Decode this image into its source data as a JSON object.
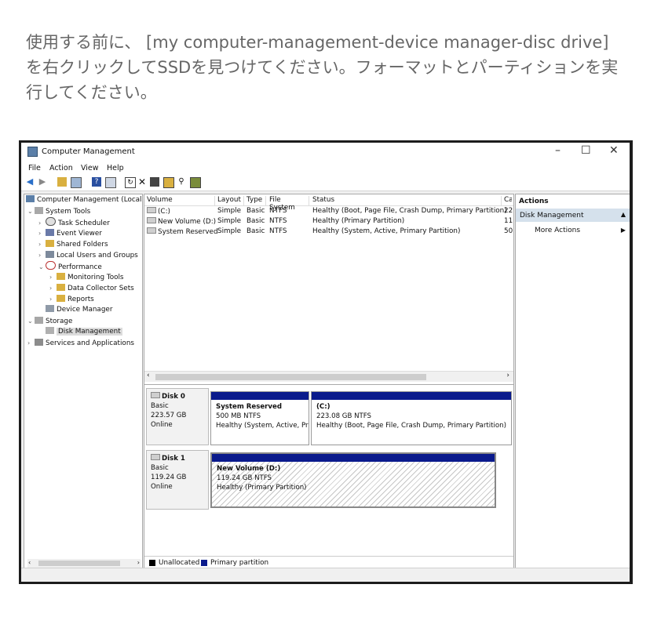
{
  "intro": {
    "text": "使用する前に、 [my computer-management-device manager-disc drive] を右クリックしてSSDを見つけてください。フォーマットとパーティションを実行してください。"
  },
  "window": {
    "title": "Computer Management",
    "controls": {
      "minimize": "–",
      "maximize": "☐",
      "close": "✕"
    }
  },
  "menu": [
    "File",
    "Action",
    "View",
    "Help"
  ],
  "tree": {
    "root": "Computer Management (Local",
    "system_tools": "System Tools",
    "task_scheduler": "Task Scheduler",
    "event_viewer": "Event Viewer",
    "shared_folders": "Shared Folders",
    "local_users": "Local Users and Groups",
    "performance": "Performance",
    "monitoring_tools": "Monitoring Tools",
    "data_collector_sets": "Data Collector Sets",
    "reports": "Reports",
    "device_manager": "Device Manager",
    "storage": "Storage",
    "disk_management": "Disk Management",
    "services": "Services and Applications"
  },
  "volume_list": {
    "columns": [
      "Volume",
      "Layout",
      "Type",
      "File System",
      "Status",
      "Ca"
    ],
    "rows": [
      {
        "volume": "(C:)",
        "layout": "Simple",
        "type": "Basic",
        "fs": "NTFS",
        "status": "Healthy (Boot, Page File, Crash Dump, Primary Partition)",
        "cap": "22"
      },
      {
        "volume": "New Volume (D:)",
        "layout": "Simple",
        "type": "Basic",
        "fs": "NTFS",
        "status": "Healthy (Primary Partition)",
        "cap": "11"
      },
      {
        "volume": "System Reserved",
        "layout": "Simple",
        "type": "Basic",
        "fs": "NTFS",
        "status": "Healthy (System, Active, Primary Partition)",
        "cap": "50"
      }
    ]
  },
  "disks": [
    {
      "name": "Disk 0",
      "type": "Basic",
      "size": "223.57 GB",
      "state": "Online",
      "partitions": [
        {
          "name": "System Reserved",
          "size": "500 MB NTFS",
          "status": "Healthy (System, Active, Prir"
        },
        {
          "name": "(C:)",
          "size": "223.08 GB NTFS",
          "status": "Healthy (Boot, Page File, Crash Dump, Primary Partition)"
        }
      ]
    },
    {
      "name": "Disk 1",
      "type": "Basic",
      "size": "119.24 GB",
      "state": "Online",
      "partitions": [
        {
          "name": "New Volume  (D:)",
          "size": "119.24 GB NTFS",
          "status": "Healthy (Primary Partition)"
        }
      ]
    }
  ],
  "legend": {
    "unallocated": "Unallocated",
    "primary": "Primary partition"
  },
  "colors": {
    "primary_partition": "#0a1a8c",
    "unallocated": "#000000",
    "selected_action": "#d5e1ec"
  },
  "actions": {
    "header": "Actions",
    "selected": "Disk Management",
    "more": "More Actions"
  }
}
